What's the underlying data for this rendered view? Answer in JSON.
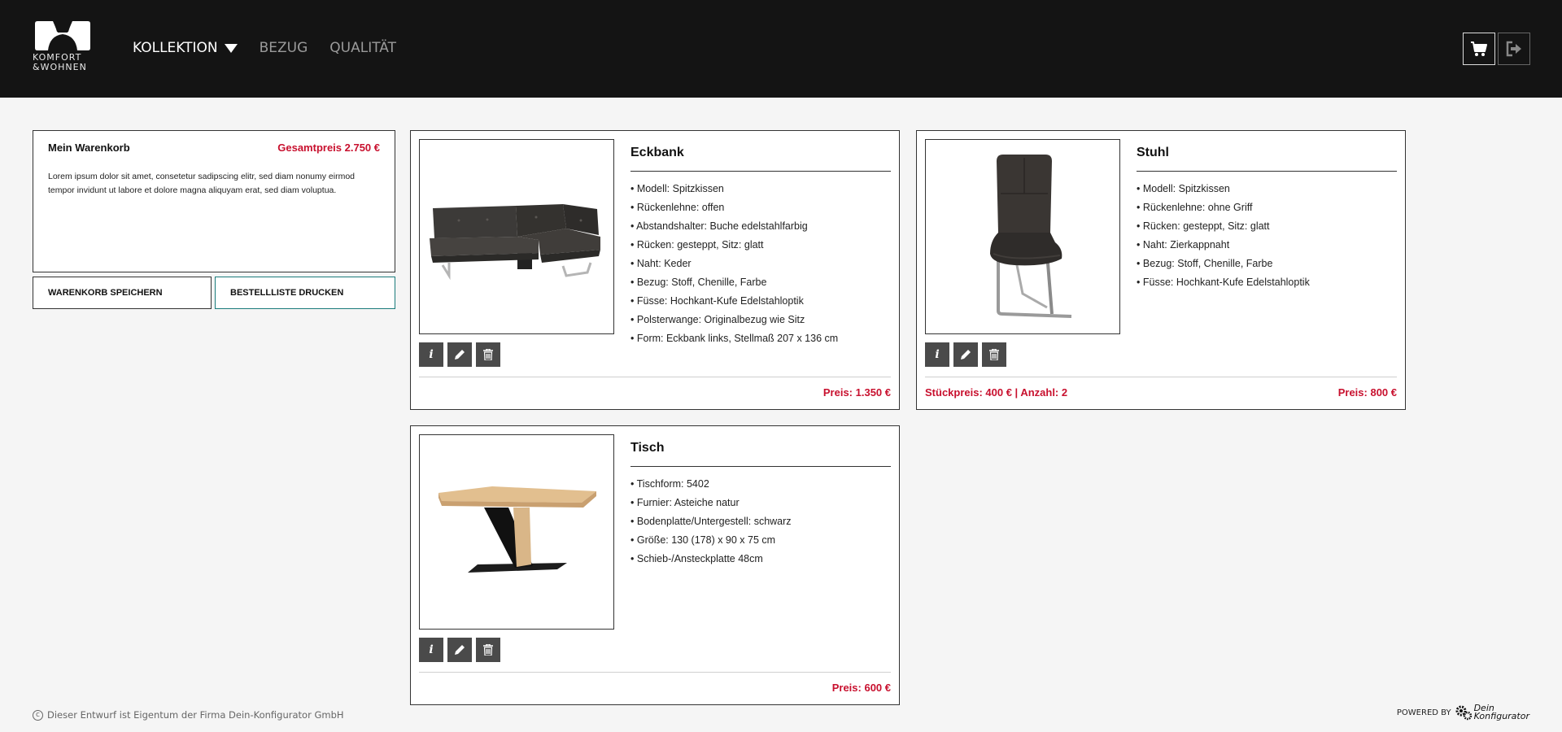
{
  "header": {
    "logo_text_line1": "KOMFORT",
    "logo_text_line2": "&WOHNEN",
    "nav": [
      {
        "label": "KOLLEKTION",
        "active": true
      },
      {
        "label": "BEZUG",
        "active": false
      },
      {
        "label": "QUALITÄT",
        "active": false
      }
    ],
    "cart_icon": "shopping-cart-icon",
    "logout_icon": "sign-out-icon"
  },
  "cart": {
    "title": "Mein Warenkorb",
    "total": "Gesamtpreis 2.750 €",
    "description": "Lorem ipsum dolor sit amet, consetetur sadipscing elitr, sed diam nonumy eirmod tempor invidunt ut labore et dolore magna aliquyam erat, sed diam voluptua.",
    "save_button": "WARENKORB SPEICHERN",
    "print_button": "BESTELLLISTE DRUCKEN"
  },
  "products": [
    {
      "name": "Eckbank",
      "specs": [
        "Modell: Spitzkissen",
        "Rückenlehne: offen",
        "Abstandshalter: Buche edelstahlfarbig",
        "Rücken: gesteppt, Sitz: glatt",
        "Naht: Keder",
        "Bezug: Stoff, Chenille, Farbe",
        "Füsse: Hochkant-Kufe Edelstahloptik",
        "Polsterwange: Originalbezug wie Sitz",
        "Form: Eckbank links, Stellmaß 207 x 136 cm"
      ],
      "price": "Preis:  1.350 €"
    },
    {
      "name": "Stuhl",
      "specs": [
        "Modell: Spitzkissen",
        "Rückenlehne: ohne Griff",
        "Rücken: gesteppt, Sitz: glatt",
        "Naht: Zierkappnaht",
        "Bezug: Stoff, Chenille, Farbe",
        "Füsse: Hochkant-Kufe Edelstahloptik"
      ],
      "unit_info": "Stückpreis:  400 €  |  Anzahl: 2",
      "price": "Preis:  800 €"
    },
    {
      "name": "Tisch",
      "specs": [
        "Tischform: 5402",
        "Furnier: Asteiche natur",
        "Bodenplatte/Untergestell: schwarz",
        "Größe: 130 (178) x 90 x 75 cm",
        "Schieb-/Ansteckplatte 48cm"
      ],
      "price": "Preis:  600 €"
    }
  ],
  "actions": {
    "info": "i",
    "edit_icon": "pencil-icon",
    "delete_icon": "trash-icon"
  },
  "footer": {
    "copyright": "Dieser Entwurf ist Eigentum der Firma Dein-Konfigurator GmbH",
    "powered_by": "POWERED BY",
    "brand_line1": "Dein",
    "brand_line2": "Konfigurator"
  },
  "colors": {
    "accent": "#c8102e",
    "header_bg": "#141414",
    "print_border": "#1a7b7b",
    "action_bg": "#4a4a4a"
  }
}
